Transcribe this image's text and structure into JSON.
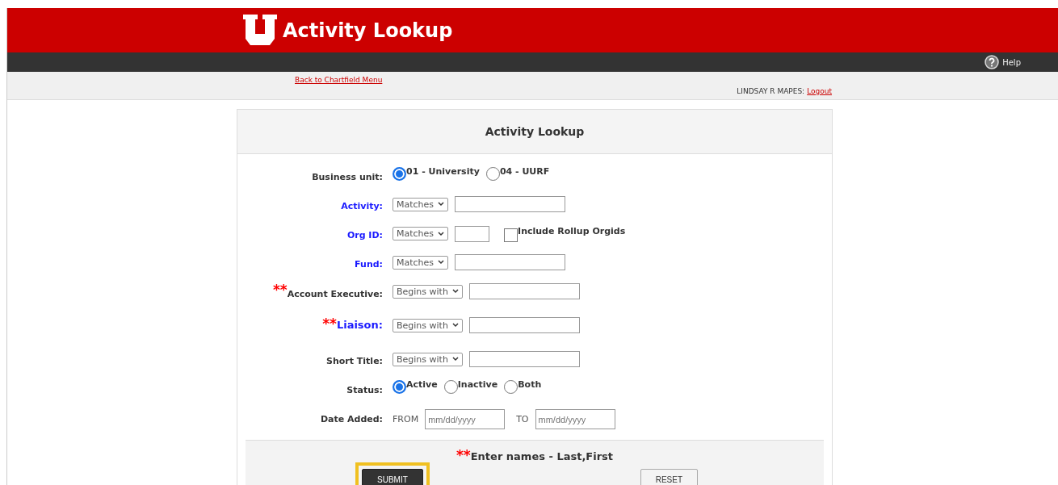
{
  "header": {
    "title": "Activity Lookup"
  },
  "nav": {
    "help": "Help"
  },
  "subbar": {
    "back_link": "Back to Chartfield Menu",
    "user": "LINDSAY R MAPES:",
    "logout": "Logout"
  },
  "form": {
    "title": "Activity Lookup",
    "fields": [
      {
        "kind": "radio",
        "label": "Business unit:",
        "link": false,
        "required": false,
        "options": [
          {
            "label": "01 - University",
            "selected": true
          },
          {
            "label": "04 - UURF",
            "selected": false
          }
        ]
      },
      {
        "kind": "match",
        "label": "Activity:",
        "link": true,
        "required": false,
        "operator": "Matches"
      },
      {
        "kind": "match_check",
        "label": "Org ID:",
        "link": true,
        "required": false,
        "operator": "Matches",
        "checkbox": {
          "label": "Include Rollup Orgids",
          "checked": false
        }
      },
      {
        "kind": "match",
        "label": "Fund:",
        "link": true,
        "required": false,
        "operator": "Matches"
      },
      {
        "kind": "match",
        "label": "Account Executive:",
        "link": false,
        "required": true,
        "required_mark": "**",
        "operator": "Begins with"
      },
      {
        "kind": "match",
        "label": "Liaison:",
        "link": true,
        "required": true,
        "required_mark": "**",
        "operator": "Begins with"
      },
      {
        "kind": "match",
        "label": "Short Title:",
        "link": false,
        "required": false,
        "operator": "Begins with"
      },
      {
        "kind": "radio",
        "label": "Status:",
        "link": false,
        "required": false,
        "options": [
          {
            "label": "Active",
            "selected": true
          },
          {
            "label": "Inactive",
            "selected": false
          },
          {
            "label": "Both",
            "selected": false
          }
        ]
      },
      {
        "kind": "date",
        "label": "Date Added:",
        "link": false,
        "required": false,
        "from": "FROM",
        "to": "TO",
        "from_placeholder": "mm/dd/yyyy",
        "to_placeholder": "mm/dd/yyyy"
      }
    ],
    "note_mark": "**",
    "note": "Enter names - Last,First",
    "buttons": [
      {
        "label": "SUBMIT",
        "kind": "primary",
        "highlighted": true
      },
      {
        "label": "RESET",
        "kind": "secondary",
        "highlighted": false
      }
    ]
  }
}
